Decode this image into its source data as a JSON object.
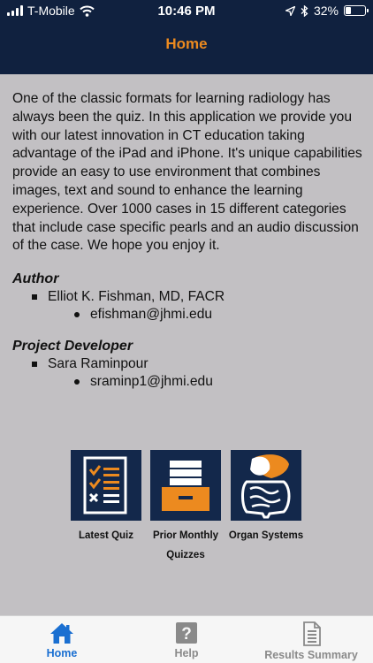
{
  "status_bar": {
    "carrier": "T-Mobile",
    "time": "10:46 PM",
    "battery": "32%",
    "battery_level": 0.32,
    "icons": [
      "signal-icon",
      "wifi-icon",
      "location-icon",
      "bluetooth-icon",
      "battery-icon"
    ]
  },
  "nav": {
    "title": "Home"
  },
  "intro": "One of the classic formats for learning radiology has always been the quiz. In this application we provide you with our latest innovation in CT education taking advantage of the iPad and iPhone. It's unique capabilities provide an easy to use environment that combines images, text and sound to enhance the learning experience. Over 1000 cases in 15 different categories that include case specific pearls and an audio discussion of the case. We hope you enjoy it.",
  "author": {
    "heading": "Author",
    "name": "Elliot K. Fishman, MD, FACR",
    "email": "efishman@jhmi.edu"
  },
  "developer": {
    "heading": "Project Developer",
    "name": "Sara Raminpour",
    "email": "sraminp1@jhmi.edu"
  },
  "tiles": [
    {
      "label": "Latest Quiz",
      "icon": "quiz-checklist-icon"
    },
    {
      "label_line1": "Prior Monthly",
      "label_line2": "Quizzes",
      "icon": "file-drawer-icon"
    },
    {
      "label": "Organ Systems",
      "icon": "organ-systems-icon"
    }
  ],
  "tabs": [
    {
      "label": "Home",
      "icon": "home-icon",
      "active": true
    },
    {
      "label": "Help",
      "icon": "help-icon",
      "active": false
    },
    {
      "label": "Results Summary",
      "icon": "results-document-icon",
      "active": false
    }
  ],
  "colors": {
    "nav_bg": "#10213f",
    "title_orange": "#ec8a1f",
    "content_bg": "#c2c0c3",
    "tile_bg": "#13284b",
    "tab_active": "#1a6fd1",
    "tab_inactive": "#8a8a8a"
  }
}
